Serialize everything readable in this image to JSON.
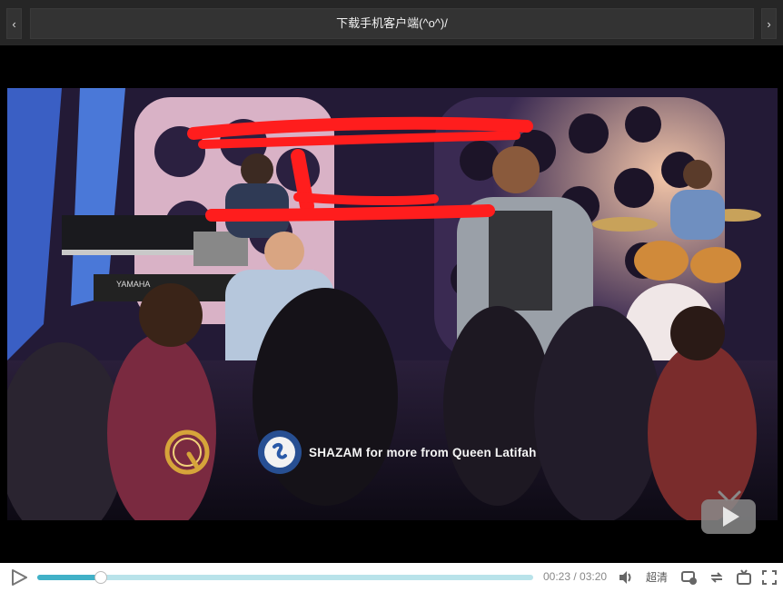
{
  "header": {
    "prev_label": "‹",
    "next_label": "›",
    "title": "下载手机客户端(^o^)/"
  },
  "video": {
    "overlay_text": "SHAZAM for more from Queen Latifah",
    "brand_keyboard": "YAMAHA",
    "logo_icon": "q-logo-icon",
    "badge_icon": "tv-play-icon"
  },
  "controls": {
    "current_time": "00:23",
    "separator": " / ",
    "duration": "03:20",
    "time_display": "00:23 / 03:20",
    "progress": 0.128,
    "quality_label": "超清",
    "icons": [
      "play-icon",
      "volume-icon",
      "barrage-icon",
      "loop-icon",
      "tv-icon",
      "fullscreen-icon"
    ]
  },
  "colors": {
    "progress_fill": "#41b1c7",
    "progress_track": "#b9e3ea",
    "topbar_bg": "#262626"
  }
}
